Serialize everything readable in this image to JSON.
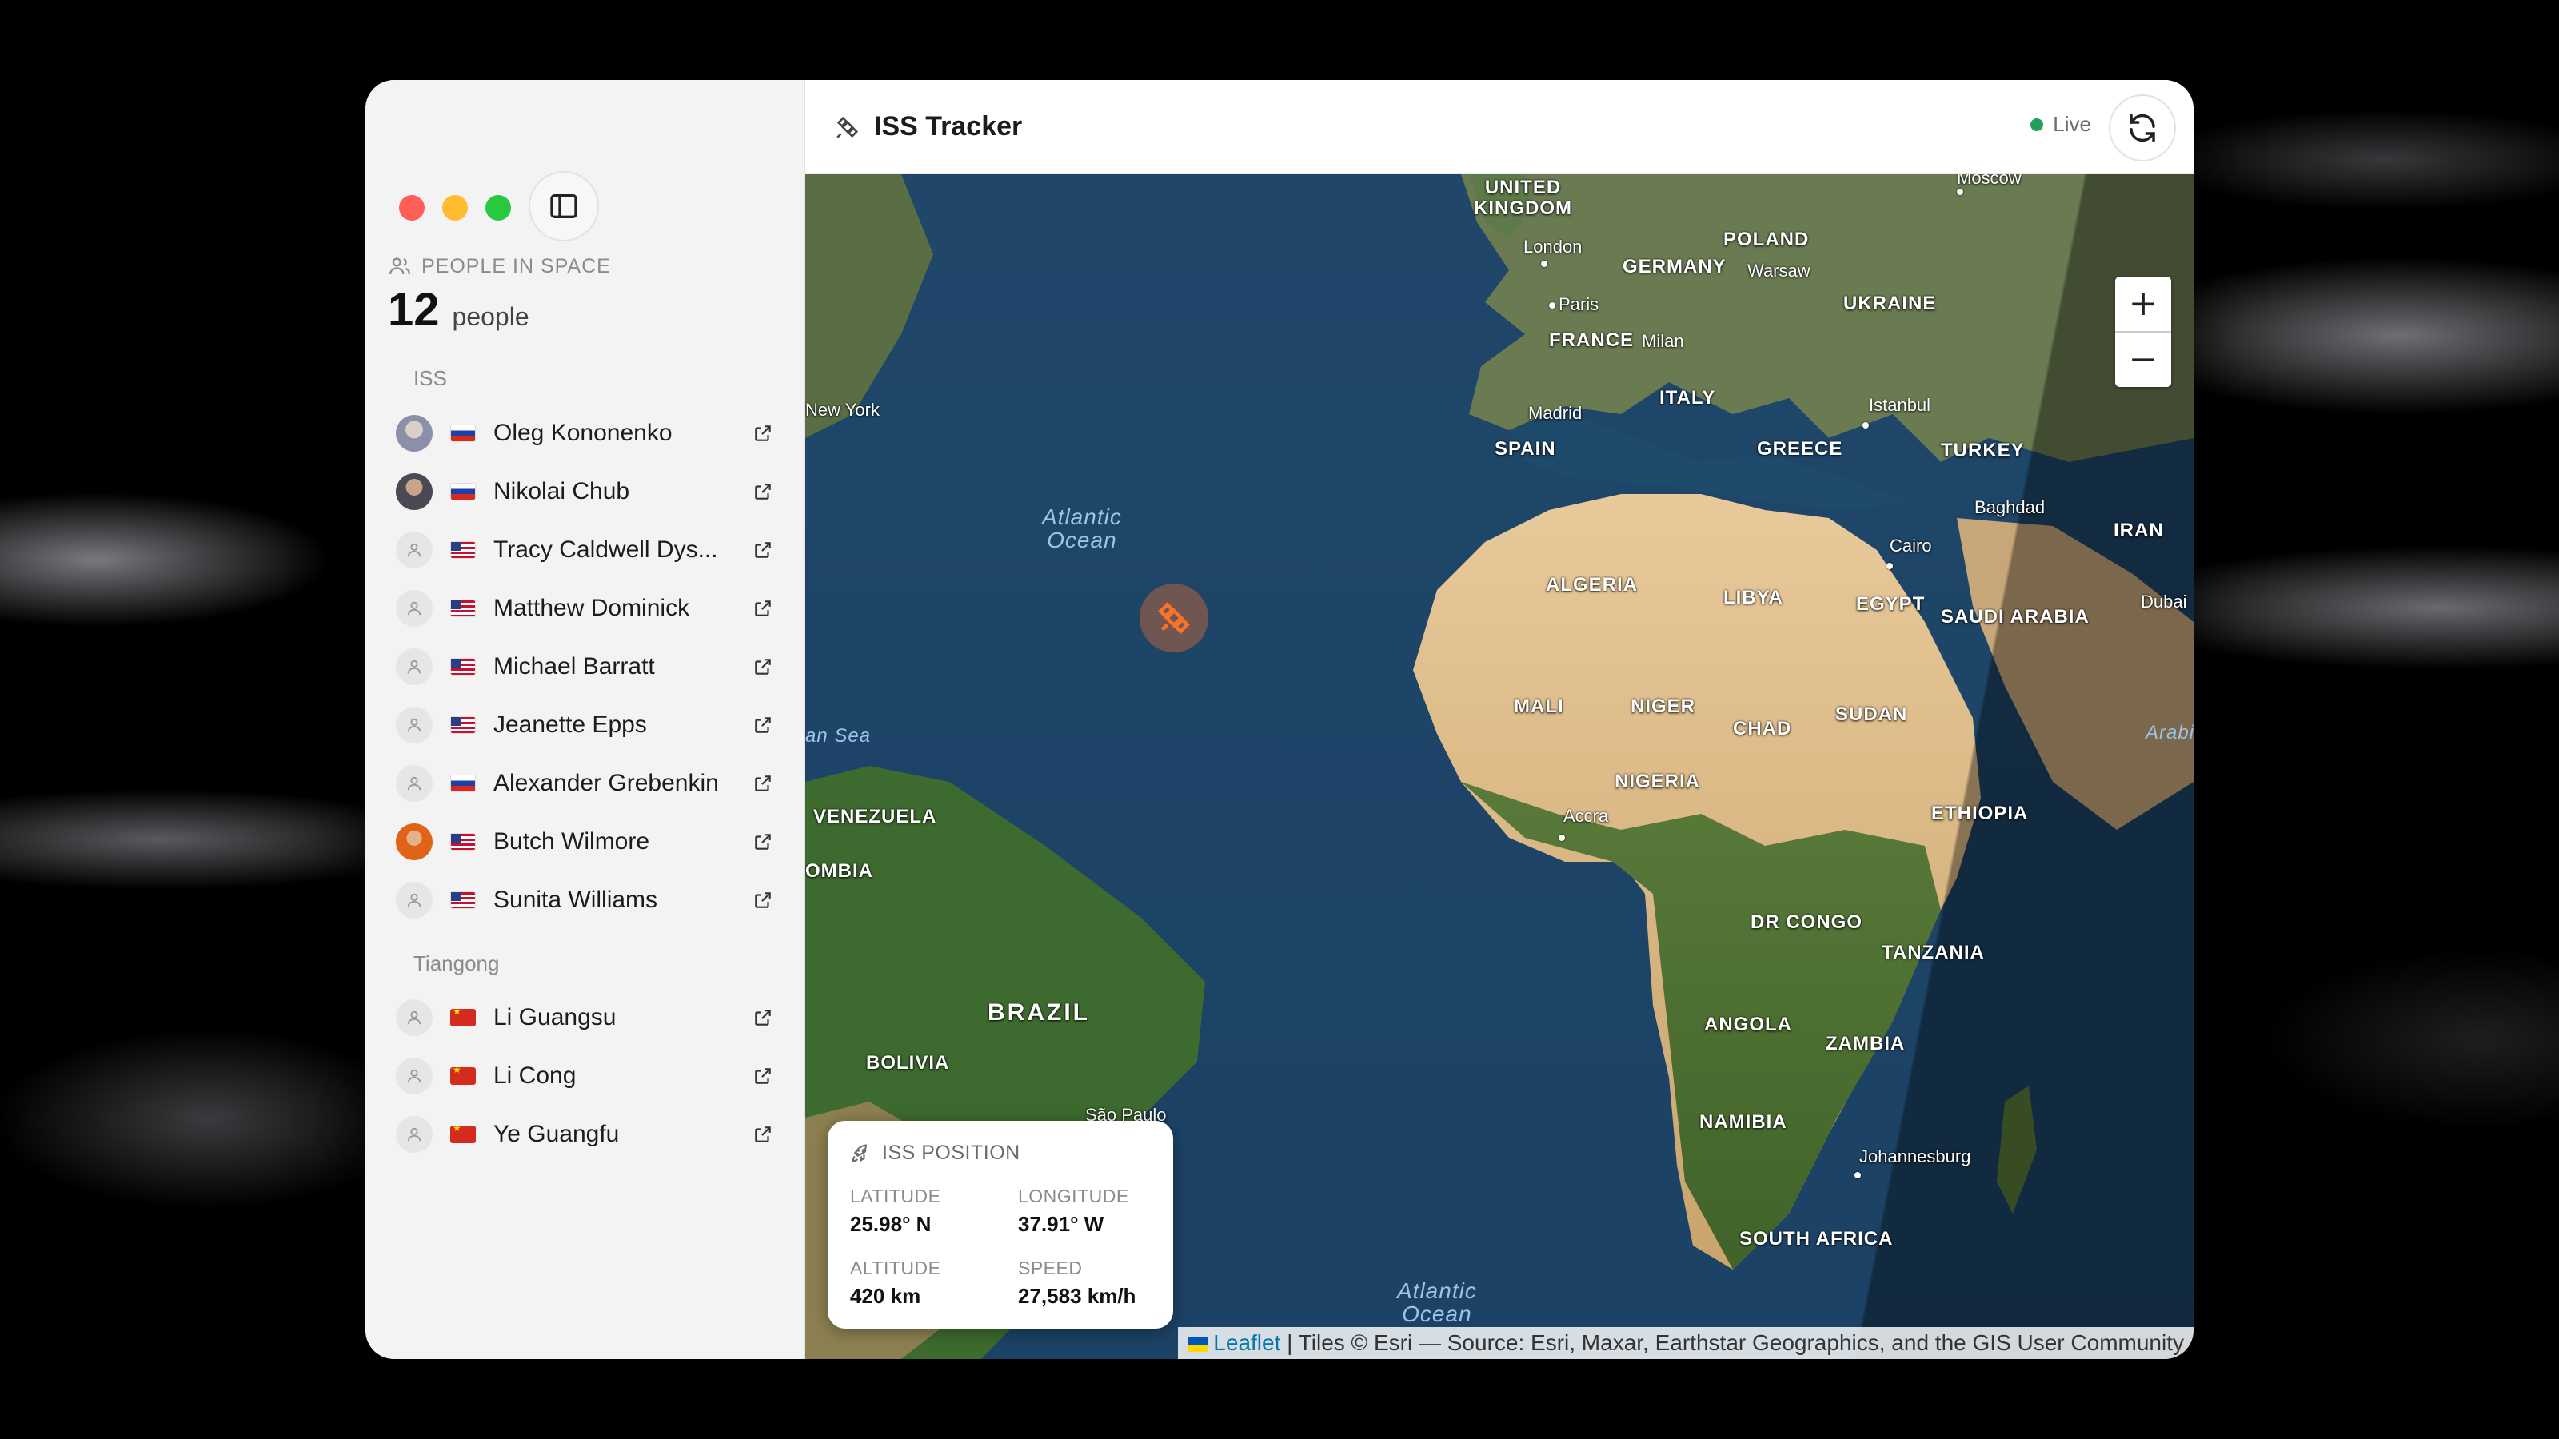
{
  "window": {
    "title": "ISS Tracker",
    "live_label": "Live"
  },
  "sidebar": {
    "header_label": "PEOPLE IN SPACE",
    "count": "12",
    "count_unit": "people",
    "groups": [
      {
        "label": "ISS",
        "people": [
          {
            "name": "Oleg Kononenko",
            "flag": "ru",
            "avatar": "photo"
          },
          {
            "name": "Nikolai Chub",
            "flag": "ru",
            "avatar": "photo"
          },
          {
            "name": "Tracy Caldwell Dys...",
            "flag": "us",
            "avatar": "placeholder"
          },
          {
            "name": "Matthew Dominick",
            "flag": "us",
            "avatar": "placeholder"
          },
          {
            "name": "Michael Barratt",
            "flag": "us",
            "avatar": "placeholder"
          },
          {
            "name": "Jeanette Epps",
            "flag": "us",
            "avatar": "placeholder"
          },
          {
            "name": "Alexander Grebenkin",
            "flag": "ru",
            "avatar": "placeholder"
          },
          {
            "name": "Butch Wilmore",
            "flag": "us",
            "avatar": "photo"
          },
          {
            "name": "Sunita Williams",
            "flag": "us",
            "avatar": "placeholder"
          }
        ]
      },
      {
        "label": "Tiangong",
        "people": [
          {
            "name": "Li Guangsu",
            "flag": "cn",
            "avatar": "placeholder"
          },
          {
            "name": "Li Cong",
            "flag": "cn",
            "avatar": "placeholder"
          },
          {
            "name": "Ye Guangfu",
            "flag": "cn",
            "avatar": "placeholder"
          }
        ]
      }
    ]
  },
  "map": {
    "zoom_in": "+",
    "zoom_out": "−",
    "labels": {
      "uk": "UNITED\nKINGDOM",
      "london": "London",
      "germany": "GERMANY",
      "poland": "POLAND",
      "warsaw": "Warsaw",
      "moscow": "Moscow",
      "ukraine": "UKRAINE",
      "paris": "Paris",
      "france": "FRANCE",
      "milan": "Milan",
      "madrid": "Madrid",
      "italy": "ITALY",
      "spain": "SPAIN",
      "istanbul": "Istanbul",
      "greece": "GREECE",
      "turkey": "TURKEY",
      "newyork": "New York",
      "atlantic_north": "Atlantic\nOcean",
      "baghdad": "Baghdad",
      "iran": "IRAN",
      "cairo": "Cairo",
      "algeria": "ALGERIA",
      "libya": "LIBYA",
      "egypt": "EGYPT",
      "saudi": "SAUDI ARABIA",
      "dubai": "Dubai",
      "mali": "MALI",
      "niger": "NIGER",
      "chad": "CHAD",
      "sudan": "SUDAN",
      "carib_sea": "an Sea",
      "arabia": "Arabi",
      "venezuela": "VENEZUELA",
      "nigeria": "NIGERIA",
      "accra": "Accra",
      "ethiopia": "ETHIOPIA",
      "colombia": "OMBIA",
      "drcongo": "DR CONGO",
      "tanzania": "TANZANIA",
      "brazil": "BRAZIL",
      "angola": "ANGOLA",
      "zambia": "ZAMBIA",
      "bolivia": "BOLIVIA",
      "namibia": "NAMIBIA",
      "johannesburg": "Johannesburg",
      "saopaulo": "São Paulo",
      "southafrica": "SOUTH AFRICA",
      "atlantic_south": "Atlantic\nOcean"
    },
    "attribution_link": "Leaflet",
    "attribution_text": " | Tiles © Esri — Source: Esri, Maxar, Earthstar Geographics, and the GIS User Community"
  },
  "iss_position": {
    "title": "ISS POSITION",
    "latitude_label": "LATITUDE",
    "latitude": "25.98° N",
    "longitude_label": "LONGITUDE",
    "longitude": "37.91° W",
    "altitude_label": "ALTITUDE",
    "altitude": "420 km",
    "speed_label": "SPEED",
    "speed": "27,583 km/h"
  },
  "colors": {
    "accent_orange": "#f6742a",
    "live_green": "#22a05a",
    "traffic_red": "#ff5f57",
    "traffic_yellow": "#febc2e",
    "traffic_green": "#28c840"
  },
  "icons": {
    "sidebar_toggle": "sidebar-icon",
    "people_header": "users-icon",
    "title": "satellite-icon",
    "refresh": "refresh-icon",
    "person_link": "external-link-icon",
    "position_card": "rocket-icon"
  }
}
